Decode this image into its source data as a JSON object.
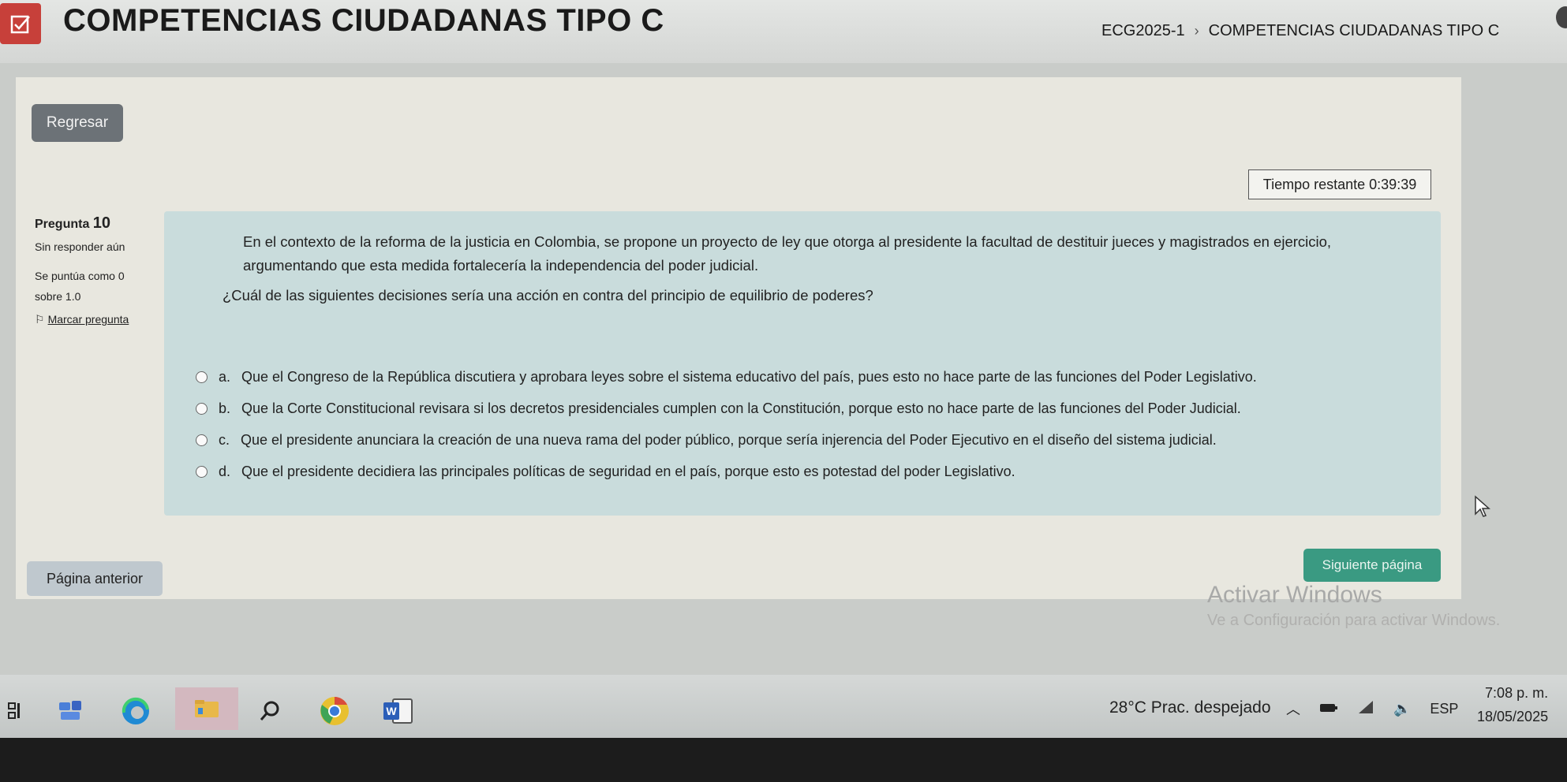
{
  "header": {
    "title": "COMPETENCIAS CIUDADANAS TIPO C",
    "breadcrumb": [
      "ECG2025-1",
      "COMPETENCIAS CIUDADANAS TIPO C"
    ],
    "icon": "checkbox-icon"
  },
  "nav": {
    "back_label": "Regresar",
    "timer_label": "Tiempo restante 0:39:39"
  },
  "question": {
    "number_label": "Pregunta",
    "number": "10",
    "state": "Sin responder aún",
    "grade": "Se puntúa como 0 sobre 1.0",
    "flag_label": "Marcar pregunta",
    "text": "En el contexto de la reforma de la justicia en Colombia, se propone un proyecto de ley que otorga al presidente la facultad de destituir jueces y magistrados en ejercicio, argumentando que esta medida fortalecería la independencia del poder judicial.",
    "prompt": "¿Cuál de las siguientes decisiones sería una acción en contra del principio de equilibrio de poderes?",
    "options": [
      {
        "letter": "a.",
        "text": "Que el Congreso de la República discutiera y aprobara leyes sobre el sistema educativo del país, pues esto no hace parte de las funciones del Poder Legislativo."
      },
      {
        "letter": "b.",
        "text": "Que la Corte Constitucional revisara si los decretos presidenciales cumplen con la Constitución, porque esto no hace parte de las funciones del Poder Judicial."
      },
      {
        "letter": "c.",
        "text": "Que el presidente anunciara la creación de una nueva rama del poder público, porque sería injerencia del Poder Ejecutivo en el diseño del sistema judicial."
      },
      {
        "letter": "d.",
        "text": "Que el presidente decidiera las principales políticas de seguridad en el país, porque esto es potestad del poder Legislativo."
      }
    ]
  },
  "footer": {
    "prev_label": "Página anterior",
    "next_label": "Siguiente página",
    "watermark_title": "Activar Windows",
    "watermark_sub": "Ve a Configuración para activar Windows."
  },
  "taskbar": {
    "weather": "28°C  Prac. despejado",
    "language": "ESP",
    "time": "7:08 p. m.",
    "date": "18/05/2025"
  },
  "colors": {
    "accent_red": "#c7403a",
    "next_button": "#3a9a82",
    "question_bg": "#c9dcdc"
  }
}
